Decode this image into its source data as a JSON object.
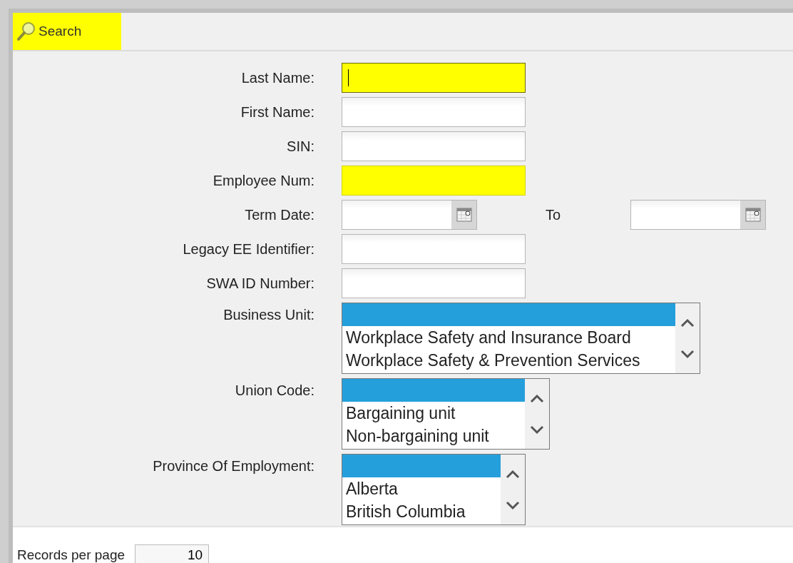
{
  "header": {
    "title": "Search",
    "highlighted": true
  },
  "fields": [
    {
      "kind": "text",
      "label": "Last Name:",
      "highlighted": true,
      "focused": true
    },
    {
      "kind": "text",
      "label": "First Name:",
      "highlighted": false,
      "focused": false
    },
    {
      "kind": "text",
      "label": "SIN:",
      "highlighted": false,
      "focused": false
    },
    {
      "kind": "text",
      "label": "Employee Num:",
      "highlighted": true,
      "focused": false
    },
    {
      "kind": "date_range",
      "label": "Term Date:",
      "to_label": "To"
    },
    {
      "kind": "text",
      "label": "Legacy EE Identifier:",
      "highlighted": false,
      "focused": false
    },
    {
      "kind": "text",
      "label": "SWA ID Number:",
      "highlighted": false,
      "focused": false
    },
    {
      "kind": "listbox",
      "label": "Business Unit:",
      "blank_selected": true,
      "options": [
        {
          "label": "Workplace Safety and Insurance Board",
          "selected": false
        },
        {
          "label": "Workplace Safety & Prevention Services",
          "selected": false
        }
      ]
    },
    {
      "kind": "listbox",
      "label": "Union Code:",
      "blank_selected": true,
      "options": [
        {
          "label": "Bargaining unit",
          "selected": false
        },
        {
          "label": "Non-bargaining unit",
          "selected": false
        }
      ]
    },
    {
      "kind": "listbox",
      "label": "Province Of Employment:",
      "blank_selected": true,
      "options": [
        {
          "label": "Alberta",
          "selected": false
        },
        {
          "label": "British Columbia",
          "selected": false
        }
      ]
    }
  ],
  "records_per_page": {
    "label": "Records per page",
    "value": "10"
  }
}
